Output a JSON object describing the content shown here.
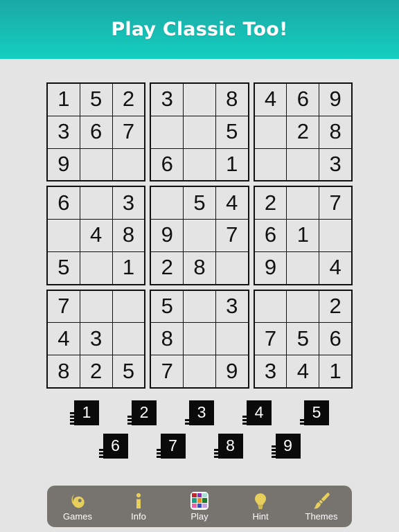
{
  "header": {
    "title": "Play Classic Too!",
    "gradient_top": "#1aa8a6",
    "gradient_bottom": "#13cfc0"
  },
  "board": {
    "blocks": [
      {
        "name": "block-top-left",
        "cells": [
          "1",
          "5",
          "2",
          "3",
          "6",
          "7",
          "9",
          "",
          ""
        ]
      },
      {
        "name": "block-top-center",
        "cells": [
          "3",
          "",
          "8",
          "",
          "",
          "5",
          "6",
          "",
          "1"
        ]
      },
      {
        "name": "block-top-right",
        "cells": [
          "4",
          "6",
          "9",
          "",
          "2",
          "8",
          "",
          "",
          "3"
        ]
      },
      {
        "name": "block-middle-left",
        "cells": [
          "6",
          "",
          "3",
          "",
          "4",
          "8",
          "5",
          "",
          "1"
        ]
      },
      {
        "name": "block-middle-center",
        "cells": [
          "",
          "5",
          "4",
          "9",
          "",
          "7",
          "2",
          "8",
          ""
        ]
      },
      {
        "name": "block-middle-right",
        "cells": [
          "2",
          "",
          "7",
          "6",
          "1",
          "",
          "9",
          "",
          "4"
        ]
      },
      {
        "name": "block-bottom-left",
        "cells": [
          "7",
          "",
          "",
          "4",
          "3",
          "",
          "8",
          "2",
          "5"
        ]
      },
      {
        "name": "block-bottom-center",
        "cells": [
          "5",
          "",
          "3",
          "8",
          "",
          "",
          "7",
          "",
          "9"
        ]
      },
      {
        "name": "block-bottom-right",
        "cells": [
          "",
          "",
          "2",
          "7",
          "5",
          "6",
          "3",
          "4",
          "1"
        ]
      }
    ],
    "rows": [
      [
        "1",
        "5",
        "2",
        "3",
        "",
        "8",
        "4",
        "6",
        "9"
      ],
      [
        "3",
        "6",
        "7",
        "",
        "",
        "5",
        "",
        "2",
        "8"
      ],
      [
        "9",
        "",
        "",
        "6",
        "",
        "1",
        "",
        "",
        "3"
      ],
      [
        "6",
        "",
        "3",
        "",
        "5",
        "4",
        "2",
        "",
        "7"
      ],
      [
        "",
        "4",
        "8",
        "9",
        "",
        "7",
        "6",
        "1",
        ""
      ],
      [
        "5",
        "",
        "1",
        "2",
        "8",
        "",
        "9",
        "",
        "4"
      ],
      [
        "7",
        "",
        "",
        "5",
        "",
        "3",
        "",
        "",
        "2"
      ],
      [
        "4",
        "3",
        "",
        "8",
        "",
        "",
        "7",
        "5",
        "6"
      ],
      [
        "8",
        "2",
        "5",
        "7",
        "",
        "9",
        "3",
        "4",
        "1"
      ]
    ],
    "cell_text_color": "#111111",
    "cell_background": "#e4e4e4",
    "line_color": "#111111"
  },
  "numpad": {
    "row1": [
      {
        "digit": "1",
        "remaining": 4
      },
      {
        "digit": "2",
        "remaining": 3
      },
      {
        "digit": "3",
        "remaining": 2
      },
      {
        "digit": "4",
        "remaining": 3
      },
      {
        "digit": "5",
        "remaining": 2
      }
    ],
    "row2": [
      {
        "digit": "6",
        "remaining": 3
      },
      {
        "digit": "7",
        "remaining": 3
      },
      {
        "digit": "8",
        "remaining": 3
      },
      {
        "digit": "9",
        "remaining": 4
      }
    ],
    "button_color": "#0a0a0a",
    "digit_color": "#ffffff"
  },
  "toolbar": {
    "background": "#77736f",
    "icon_color": "#e8cf5c",
    "items": [
      {
        "label": "Games",
        "icon": "games-icon"
      },
      {
        "label": "Info",
        "icon": "info-icon"
      },
      {
        "label": "Play",
        "icon": "play-color-grid-icon"
      },
      {
        "label": "Hint",
        "icon": "lightbulb-icon"
      },
      {
        "label": "Themes",
        "icon": "paintbrush-icon"
      }
    ],
    "play_icon_colors": [
      "#c0272d",
      "#8e2fb5",
      "#a8dfd4",
      "#16a085",
      "#f08a1e",
      "#1d7a2e",
      "#f25fa8",
      "#3b4fc4",
      "#c79fe0"
    ]
  }
}
